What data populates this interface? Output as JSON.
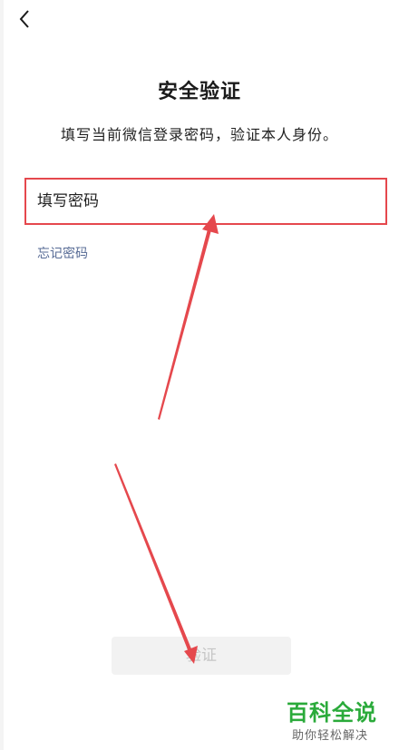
{
  "header": {
    "back_icon": "chevron-left-icon"
  },
  "title": "安全验证",
  "subtitle": "填写当前微信登录密码，验证本人身份。",
  "password_field": {
    "placeholder": "填写密码",
    "value": ""
  },
  "forgot_link": "忘记密码",
  "verify_button": "验证",
  "watermark": {
    "title": "百科全说",
    "subtitle": "助你轻松解决"
  },
  "colors": {
    "highlight_red": "#e5484d",
    "link_blue": "#576b95",
    "button_bg": "#f2f2f2",
    "watermark_green": "#2aaa3a"
  }
}
